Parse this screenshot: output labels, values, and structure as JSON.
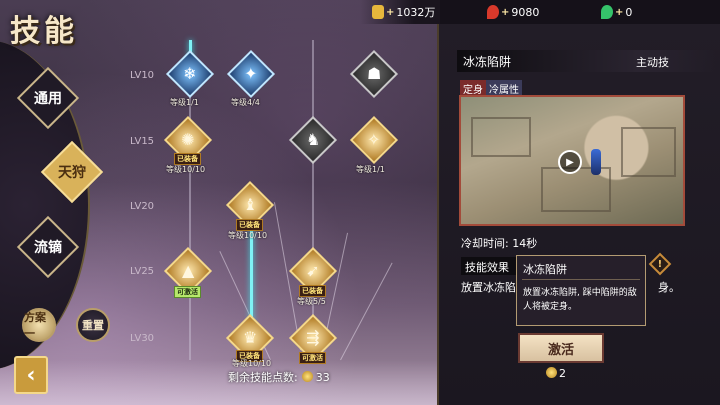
{
  "title": "技能",
  "currency": {
    "gold": "1032万",
    "red_gem": "9080",
    "green_gem": "0",
    "plus": "+"
  },
  "side_menu": {
    "items": [
      {
        "label": "通用"
      },
      {
        "label": "天狩"
      },
      {
        "label": "流镝"
      }
    ],
    "small_buttons": [
      {
        "label": "方案一"
      },
      {
        "label": "重置"
      }
    ]
  },
  "levels": [
    "LV10",
    "LV15",
    "LV20",
    "LV25",
    "LV30"
  ],
  "nodes": {
    "n1_text": "等级1/1",
    "n2_text": "等级4/4",
    "n4_text": "等级10/10",
    "n4_tag": "已装备",
    "n6_text": "等级1/1",
    "n7_tag": "已装备",
    "n7_text": "等级10/10",
    "n8_tag": "可激活",
    "n9_tag": "已装备",
    "n9_text": "等级5/5",
    "n10_tag": "已装备",
    "n10_text": "等级10/10",
    "n11_tag": "可激活"
  },
  "points": {
    "label": "剩余技能点数:",
    "value": "33"
  },
  "detail": {
    "name": "冰冻陷阱",
    "type": "主动技",
    "tags": [
      "定身",
      "冷属性"
    ],
    "cooldown": "冷却时间: 14秒",
    "effect_head": "技能效果",
    "effect_text": "放置冰冻陷",
    "effect_text_tail": "身。",
    "tooltip_title": "冰冻陷阱",
    "tooltip_body": "放置冰冻陷阱, 踩中陷阱的敌人将被定身。",
    "activate": "激活",
    "cost": "2"
  },
  "colors": {
    "accent_gold": "#d9b25a",
    "glow_line": "#7ff2f5",
    "panel_bg": "#1b1720"
  }
}
